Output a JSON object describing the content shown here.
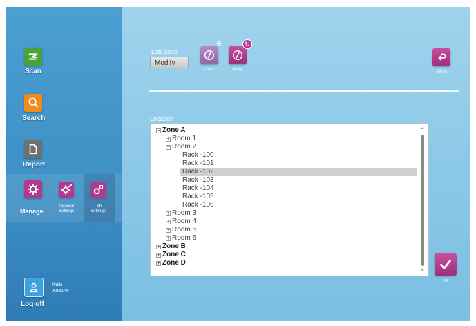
{
  "sidebar": {
    "scan_label": "Scan",
    "search_label": "Search",
    "report_label": "Report",
    "manage_label": "Manage",
    "general_settings_label": "General\nSettings",
    "lab_settings_label": "Lab\nSettings",
    "logoff_label": "Log off",
    "user_first": "Pablo",
    "user_last": "JORDAN"
  },
  "toolbar": {
    "lab_zone_label": "Lab Zone",
    "mode_value": "Modify",
    "create_label": "Create",
    "modify_label": "Modify",
    "return_label": "Return"
  },
  "location": {
    "label": "Location",
    "tree": [
      {
        "label": "Zone A",
        "level": 0,
        "expander": "−",
        "zone": true
      },
      {
        "label": "Room 1",
        "level": 1,
        "expander": "+"
      },
      {
        "label": "Room 2",
        "level": 1,
        "expander": "−"
      },
      {
        "label": "Rack -100",
        "level": 2
      },
      {
        "label": "Rack -101",
        "level": 2
      },
      {
        "label": "Rack -102",
        "level": 2,
        "selected": true
      },
      {
        "label": "Rack -103",
        "level": 2
      },
      {
        "label": "Rack -104",
        "level": 2
      },
      {
        "label": "Rack -105",
        "level": 2
      },
      {
        "label": "Rack -106",
        "level": 2
      },
      {
        "label": "Room 3",
        "level": 1,
        "expander": "+"
      },
      {
        "label": "Room 4",
        "level": 1,
        "expander": "+"
      },
      {
        "label": "Room 5",
        "level": 1,
        "expander": "+"
      },
      {
        "label": "Room 6",
        "level": 1,
        "expander": "+"
      },
      {
        "label": "Zone B",
        "level": 0,
        "expander": "+",
        "zone": true
      },
      {
        "label": "Zone C",
        "level": 0,
        "expander": "+",
        "zone": true
      },
      {
        "label": "Zone D",
        "level": 0,
        "expander": "+",
        "zone": true
      }
    ]
  },
  "ok_label": "OK",
  "colors": {
    "scan": "#4aa23a",
    "search": "#f08c1e",
    "report": "#707070",
    "manage": "#b13a8e",
    "accent": "#c0338e"
  },
  "icons": {
    "scan": "scan-icon",
    "search": "magnifier-icon",
    "report": "document-icon",
    "manage": "gear-icon",
    "general_settings": "gear-wrench-icon",
    "lab_settings": "lab-gear-icon",
    "logoff": "user-icon",
    "create": "create-icon",
    "modify": "modify-icon",
    "return": "return-icon",
    "ok": "checkmark-icon"
  }
}
